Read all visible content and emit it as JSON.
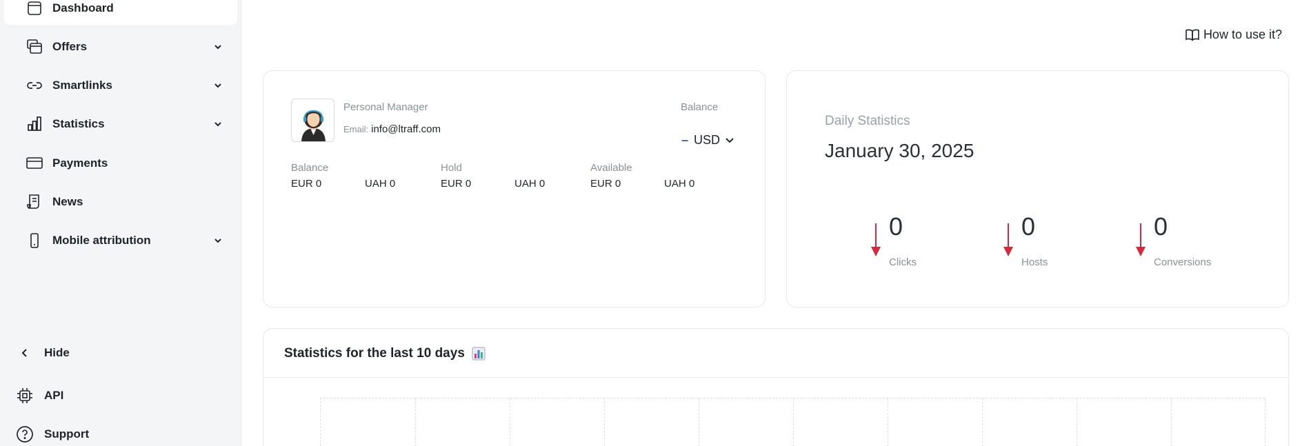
{
  "sidebar": {
    "items": [
      {
        "label": "Dashboard",
        "icon": "dashboard-icon",
        "active": true
      },
      {
        "label": "Offers",
        "icon": "offers-icon",
        "has_submenu": true
      },
      {
        "label": "Smartlinks",
        "icon": "link-icon",
        "has_submenu": true
      },
      {
        "label": "Statistics",
        "icon": "bar-chart-icon",
        "has_submenu": true
      },
      {
        "label": "Payments",
        "icon": "card-icon"
      },
      {
        "label": "News",
        "icon": "news-icon"
      },
      {
        "label": "Mobile attribution",
        "icon": "mobile-icon",
        "has_submenu": true
      }
    ],
    "bottom": {
      "hide_label": "Hide",
      "api_label": "API",
      "support_label": "Support"
    }
  },
  "header": {
    "howto_label": "How to use it?"
  },
  "manager": {
    "title": "Personal Manager",
    "email_label": "Email:",
    "email": "info@ltraff.com",
    "balance_label": "Balance",
    "currency_dash": "–",
    "currency": "USD"
  },
  "balances": {
    "balance": {
      "title": "Balance",
      "eur": "EUR 0",
      "uah": "UAH 0"
    },
    "hold": {
      "title": "Hold",
      "eur": "EUR 0",
      "uah": "UAH 0"
    },
    "available": {
      "title": "Available",
      "eur": "EUR 0",
      "uah": "UAH 0"
    }
  },
  "daily": {
    "title": "Daily Statistics",
    "date": "January 30, 2025",
    "metrics": [
      {
        "value": "0",
        "label": "Clicks",
        "trend": "down"
      },
      {
        "value": "0",
        "label": "Hosts",
        "trend": "down"
      },
      {
        "value": "0",
        "label": "Conversions",
        "trend": "down"
      }
    ]
  },
  "stats": {
    "title": "Statistics for the last 10 days"
  },
  "colors": {
    "accent": "#3b5bd6",
    "down_arrow": "#d6293d",
    "sidebar_bg": "#f4f5f7"
  }
}
